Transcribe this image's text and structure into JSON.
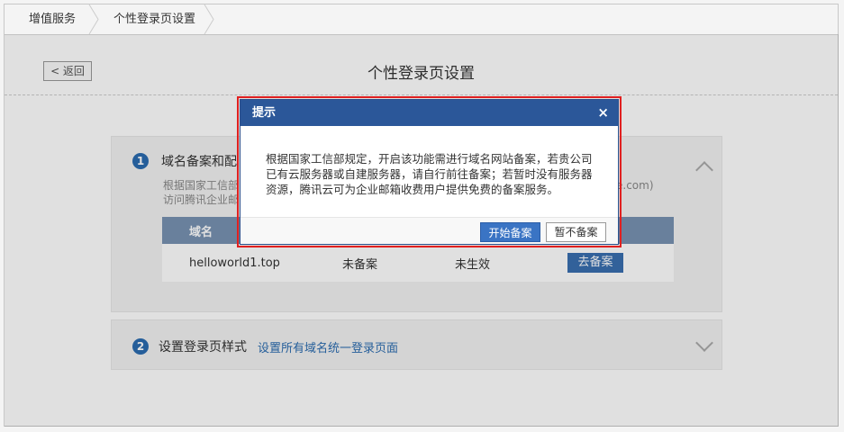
{
  "breadcrumb": {
    "items": [
      {
        "label": "增值服务"
      },
      {
        "label": "个性登录页设置"
      }
    ]
  },
  "header": {
    "back_label": "< 返回",
    "title": "个性登录页设置"
  },
  "section1": {
    "step": "1",
    "title": "域名备案和配",
    "desc_line1": "根据国家工信部",
    "desc_line1_tail": "e.com)",
    "desc_line2": "访问腾讯企业邮",
    "table": {
      "columns": [
        "域名"
      ],
      "rows": [
        {
          "domain": "helloworld1.top",
          "status": "未备案",
          "effect": "未生效",
          "action": "去备案"
        }
      ]
    }
  },
  "section2": {
    "step": "2",
    "title": "设置登录页样式",
    "link": "设置所有域名统一登录页面"
  },
  "modal": {
    "title": "提示",
    "close": "×",
    "body": "根据国家工信部规定，开启该功能需进行域名网站备案，若贵公司已有云服务器或自建服务器，请自行前往备案；若暂时没有服务器资源，腾讯云可为企业邮箱收费用户提供免费的备案服务。",
    "confirm_label": "开始备案",
    "cancel_label": "暂不备案"
  },
  "colors": {
    "accent": "#2b5799",
    "highlight_border": "#e02020",
    "table_header": "#7892b2"
  }
}
